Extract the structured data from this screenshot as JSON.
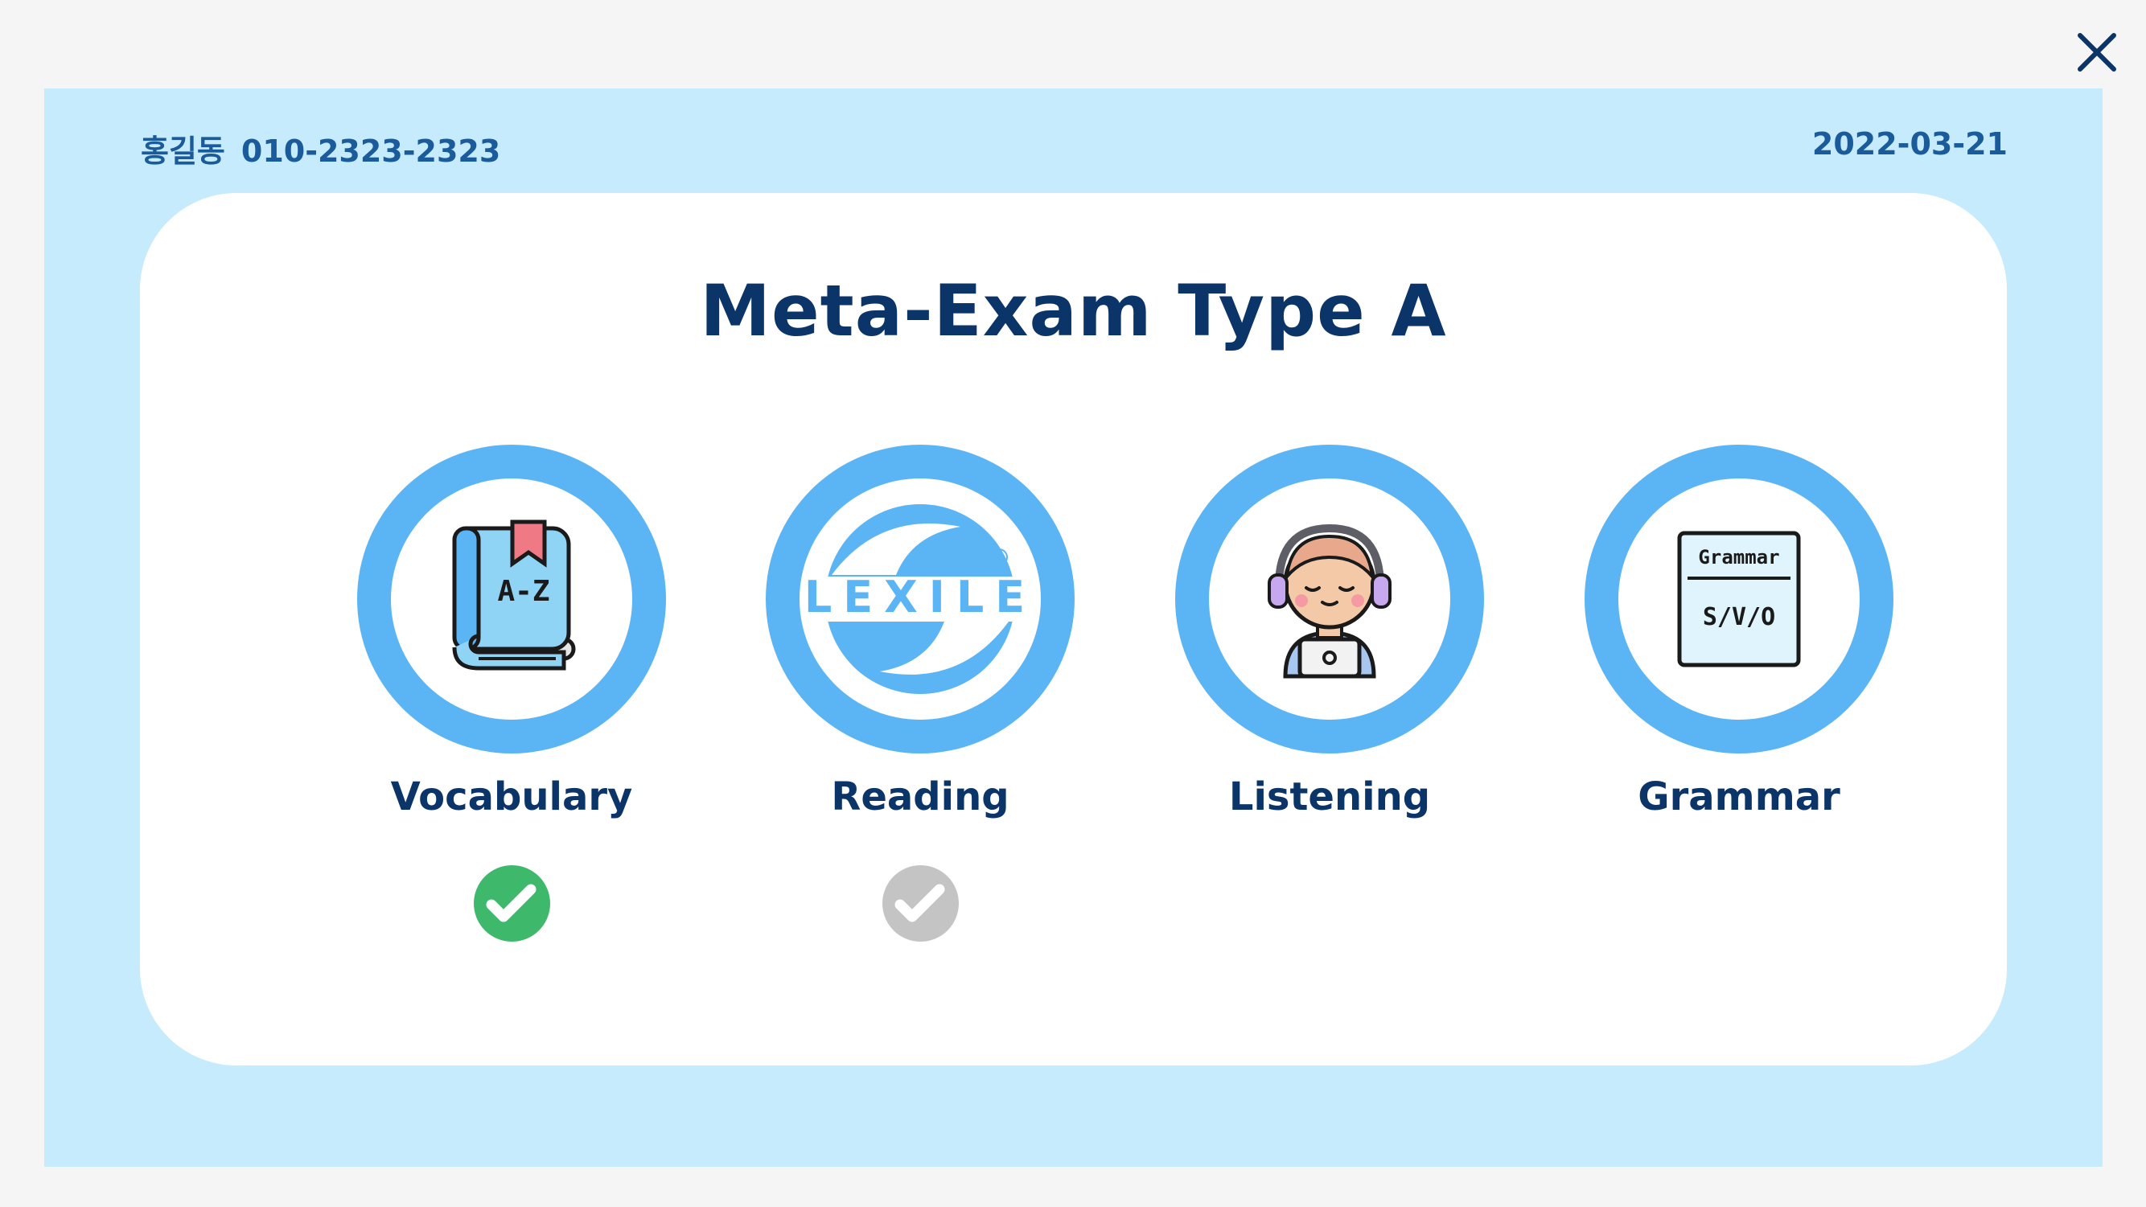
{
  "header": {
    "user_name": "홍길동",
    "phone": "010-2323-2323",
    "date": "2022-03-21"
  },
  "main": {
    "title": "Meta-Exam Type A",
    "sections": [
      {
        "label": "Vocabulary",
        "icon": "dictionary-book-icon",
        "icon_text": "A-Z",
        "status": "completed"
      },
      {
        "label": "Reading",
        "icon": "lexile-logo",
        "icon_text": "LEXILE",
        "status": "pending"
      },
      {
        "label": "Listening",
        "icon": "student-headphones-icon",
        "status": "none"
      },
      {
        "label": "Grammar",
        "icon": "grammar-sheet-icon",
        "icon_text_top": "Grammar",
        "icon_text_bottom": "S/V/O",
        "status": "none"
      }
    ]
  },
  "colors": {
    "background": "#f5f5f5",
    "panel": "#c6ebfc",
    "card": "#ffffff",
    "ring": "#5bb5f4",
    "title": "#0b3569",
    "header_text": "#1a5b9b",
    "check_completed": "#3eb86b",
    "check_pending": "#c4c4c4"
  }
}
